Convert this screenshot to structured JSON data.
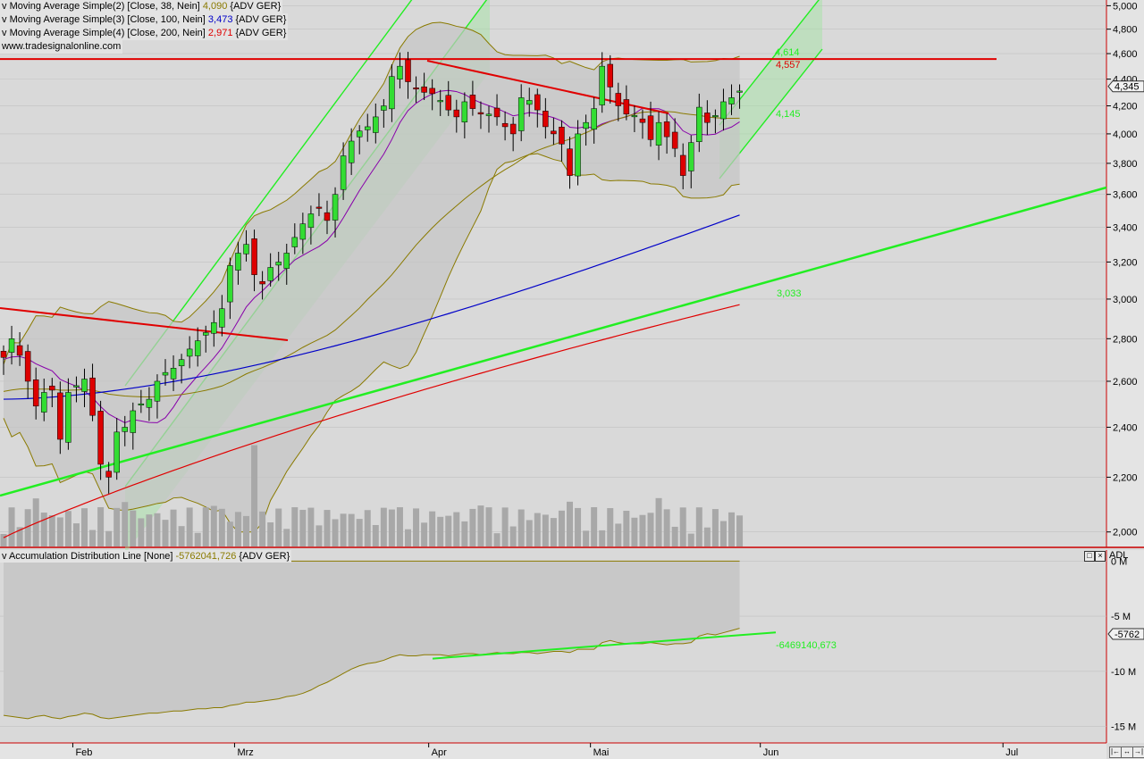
{
  "legend": [
    {
      "prefix": "v ",
      "text": "Moving Average Simple(2) [Close, 38, Nein] ",
      "value": "4,090",
      "suffix": " {ADV GER}",
      "color": "#8a7a00"
    },
    {
      "prefix": "v ",
      "text": "Moving Average Simple(3) [Close, 100, Nein] ",
      "value": "3,473",
      "suffix": " {ADV GER}",
      "color": "#0000c8"
    },
    {
      "prefix": "v ",
      "text": "Moving Average Simple(4) [Close, 200, Nein] ",
      "value": "2,971",
      "suffix": " {ADV GER}",
      "color": "#e00000"
    }
  ],
  "watermark": "www.tradesignalonline.com",
  "adl_panel": {
    "prefix": "v ",
    "title": "Accumulation Distribution Line [None] ",
    "value": "-5762041,726",
    "suffix": " {ADV GER}",
    "tag": "ADL",
    "last_label": "-5762",
    "trend_label": "-6469140,673"
  },
  "price_labels": {
    "top_red": "4,557",
    "top_green": "4,614",
    "mid_green": "4,145",
    "lower_green": "3,033",
    "current": "4,345"
  },
  "colors": {
    "up": "#33dd33",
    "down": "#dd0000",
    "ma38": "#8a7a00",
    "ma100": "#0000c8",
    "ma200": "#e00000",
    "trend_green": "#22ee22",
    "trend_red": "#e00000",
    "volume": "#a8a8a8"
  },
  "chart_data": {
    "type": "candlestick",
    "y_axis": {
      "labels": [
        "5,000",
        "4,800",
        "4,600",
        "4,400",
        "4,200",
        "4,000",
        "3,800",
        "3,600",
        "3,400",
        "3,200",
        "3,000",
        "2,800",
        "2,600",
        "2,400",
        "2,200",
        "2,000"
      ],
      "scale": "log",
      "range": [
        1.95,
        5.05
      ]
    },
    "x_axis": {
      "labels": [
        "Feb",
        "Mrz",
        "Apr",
        "Mai",
        "Jun",
        "Jul"
      ]
    },
    "adl_axis": {
      "labels": [
        "0 M",
        "-5 M",
        "-10 M",
        "-15 M"
      ],
      "range": [
        -16500000,
        1000000
      ]
    },
    "closes": [
      2.71,
      2.8,
      2.72,
      2.6,
      2.49,
      2.55,
      2.56,
      2.35,
      2.55,
      2.58,
      2.61,
      2.45,
      2.25,
      2.2,
      2.38,
      2.4,
      2.47,
      2.5,
      2.52,
      2.6,
      2.64,
      2.66,
      2.7,
      2.75,
      2.79,
      2.83,
      2.88,
      2.95,
      3.18,
      3.25,
      3.3,
      3.13,
      3.08,
      3.17,
      3.2,
      3.25,
      3.34,
      3.42,
      3.48,
      3.52,
      3.44,
      3.6,
      3.85,
      3.95,
      4.02,
      4.05,
      4.12,
      4.2,
      4.42,
      4.5,
      4.38,
      4.33,
      4.3,
      4.29,
      4.24,
      4.17,
      4.12,
      4.23,
      4.18,
      4.14,
      4.14,
      4.12,
      4.05,
      4.0,
      4.26,
      4.24,
      4.17,
      4.05,
      4.0,
      3.93,
      3.72,
      4.0,
      4.08,
      4.18,
      4.5,
      4.34,
      4.2,
      4.14,
      4.13,
      4.08,
      3.96,
      4.08,
      3.98,
      3.9,
      3.72,
      3.94,
      4.19,
      4.08,
      4.13,
      4.23,
      4.26,
      4.31
    ],
    "adl": [
      -14000000,
      -14100000,
      -14200000,
      -14300000,
      -14100000,
      -14000000,
      -14200000,
      -14300000,
      -14100000,
      -14000000,
      -13800000,
      -13900000,
      -14200000,
      -14300000,
      -14200000,
      -14100000,
      -14000000,
      -13900000,
      -13800000,
      -13800000,
      -13700000,
      -13600000,
      -13600000,
      -13500000,
      -13400000,
      -13400000,
      -13300000,
      -13300000,
      -13100000,
      -13000000,
      -12800000,
      -12800000,
      -12700000,
      -12600000,
      -12500000,
      -12300000,
      -12200000,
      -12000000,
      -11700000,
      -11300000,
      -11000000,
      -10600000,
      -10200000,
      -9800000,
      -9500000,
      -9300000,
      -9200000,
      -9000000,
      -8700000,
      -8500000,
      -8600000,
      -8600000,
      -8500000,
      -8500000,
      -8500000,
      -8600000,
      -8500000,
      -8400000,
      -8400000,
      -8500000,
      -8400000,
      -8300000,
      -8400000,
      -8400000,
      -8300000,
      -8300000,
      -8400000,
      -8300000,
      -8200000,
      -8200000,
      -8300000,
      -8000000,
      -8000000,
      -8000000,
      -7400000,
      -7200000,
      -7400000,
      -7500000,
      -7500000,
      -7500000,
      -7400000,
      -7500000,
      -7600000,
      -7500000,
      -7500000,
      -7400000,
      -6800000,
      -6600000,
      -6700000,
      -6500000,
      -6300000,
      -6100000
    ]
  }
}
